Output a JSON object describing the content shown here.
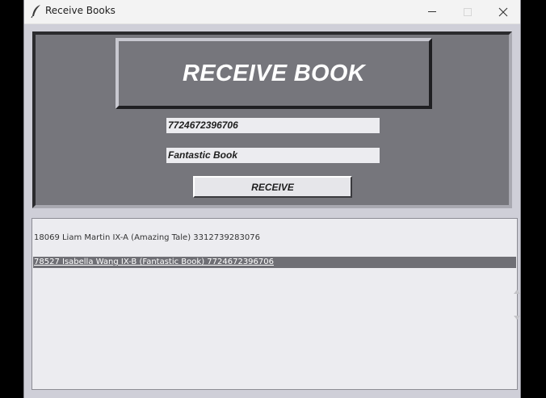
{
  "window": {
    "title": "Receive Books",
    "icon": "feather-icon",
    "controls": [
      "minimize-icon",
      "maximize-icon",
      "close-icon"
    ]
  },
  "form": {
    "heading": "RECEIVE BOOK",
    "isbn_value": "7724672396706",
    "title_value": "Fantastic Book",
    "receive_label": "RECEIVE"
  },
  "list": {
    "rows": [
      "18069 Liam Martin IX-A (Amazing Tale) 3312739283076",
      "78527 Isabella Wang IX-B (Fantastic Book) 7724672396706"
    ],
    "selected_index": 1
  },
  "colors": {
    "frame_bg": "#76767c",
    "field_bg": "#ececf0",
    "selection_bg": "#6f6f75"
  }
}
